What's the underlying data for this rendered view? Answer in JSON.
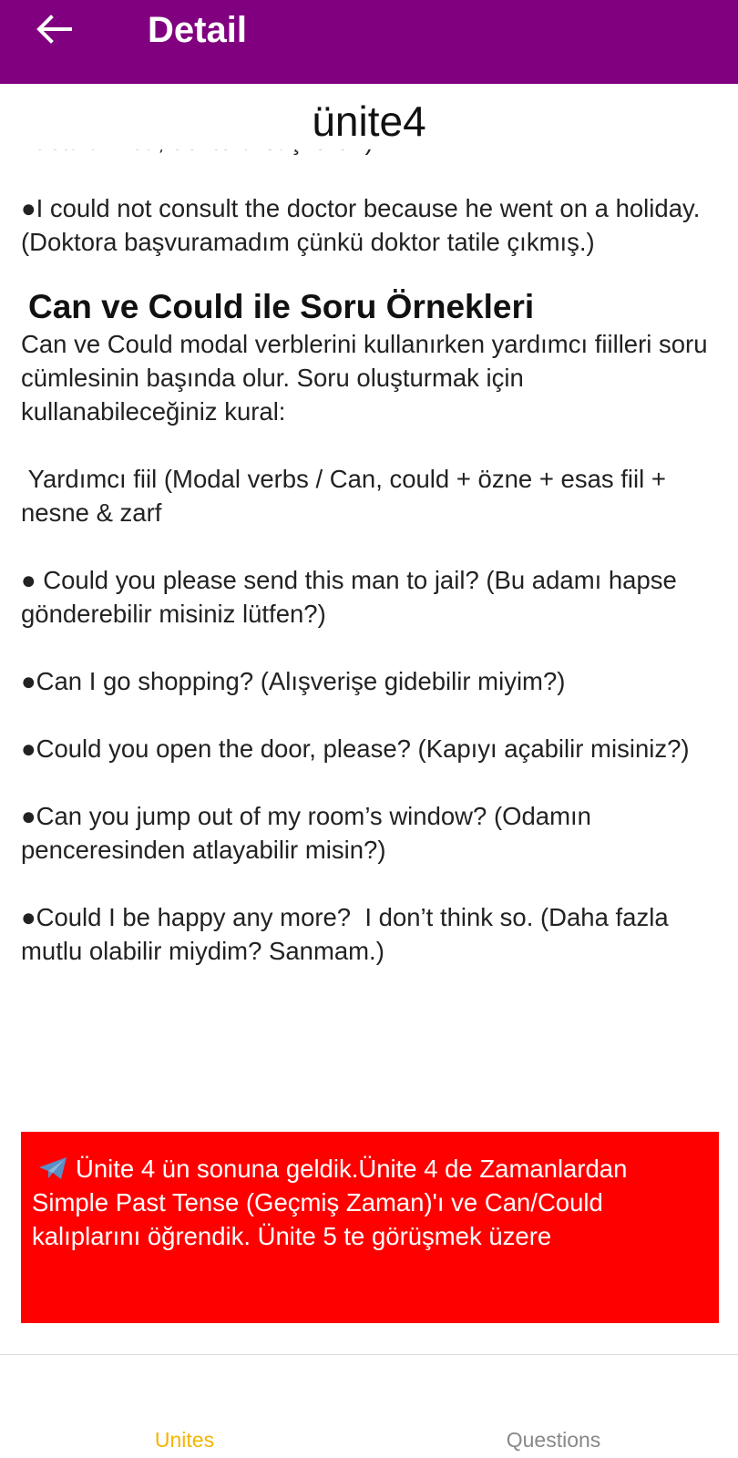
{
  "appbar": {
    "back_icon": "arrow-left-icon",
    "title": "Detail",
    "background": "#800080"
  },
  "content": {
    "unit_title": "ünite4",
    "cut_line": "hastalanırsa, doktora başvurur.)",
    "paragraphs_before": [
      "●I could not consult the doctor because he went on a holiday. (Doktora başvuramadım çünkü doktor tatile çıkmış.)"
    ],
    "section_heading": "Can ve Could ile Soru Örnekleri",
    "paragraphs_after": [
      "Can ve Could modal verblerini kullanırken yardımcı fiilleri soru cümlesinin başında olur. Soru oluşturmak için kullanabileceğiniz kural:",
      " Yardımcı fiil (Modal verbs / Can, could + özne + esas fiil + nesne & zarf",
      "● Could you please send this man to jail? (Bu adamı hapse gönderebilir misiniz lütfen?)",
      "●Can I go shopping? (Alışverişe gidebilir miyim?)",
      "●Could you open the door, please? (Kapıyı açabilir misiniz?)",
      "●Can you jump out of my room’s window? (Odamın penceresinden atlayabilir misin?)",
      "●Could I be happy any more?  I don’t think so. (Daha fazla mutlu olabilir miydim? Sanmam.)"
    ]
  },
  "notice": {
    "icon": "telegram-send-icon",
    "text": "Ünite 4 ün sonuna geldik.Ünite 4 de Zamanlardan Simple Past Tense (Geçmiş Zaman)'ı ve Can/Could kalıplarını öğrendik. Ünite 5 te görüşmek üzere",
    "background": "#ff0000"
  },
  "bottom_nav": {
    "items": [
      {
        "label": "Unites",
        "active": true,
        "color": "#f4b400"
      },
      {
        "label": "Questions",
        "active": false,
        "color": "#888888"
      }
    ]
  }
}
